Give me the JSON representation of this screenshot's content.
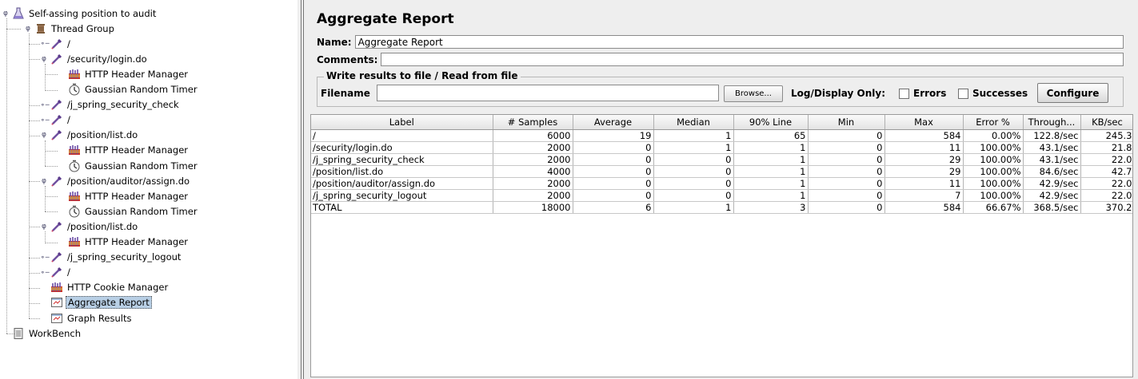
{
  "tree": {
    "items": [
      {
        "label": "Self-assing position to audit",
        "icon": "flask-icon"
      },
      {
        "label": "Thread Group",
        "icon": "spool-icon"
      },
      {
        "label": "/",
        "icon": "pipette-icon"
      },
      {
        "label": "/security/login.do",
        "icon": "pipette-icon"
      },
      {
        "label": "HTTP Header Manager",
        "icon": "header-manager-icon"
      },
      {
        "label": "Gaussian Random Timer",
        "icon": "timer-icon"
      },
      {
        "label": "/j_spring_security_check",
        "icon": "pipette-icon"
      },
      {
        "label": "/",
        "icon": "pipette-icon"
      },
      {
        "label": "/position/list.do",
        "icon": "pipette-icon"
      },
      {
        "label": "HTTP Header Manager",
        "icon": "header-manager-icon"
      },
      {
        "label": "Gaussian Random Timer",
        "icon": "timer-icon"
      },
      {
        "label": "/position/auditor/assign.do",
        "icon": "pipette-icon"
      },
      {
        "label": "HTTP Header Manager",
        "icon": "header-manager-icon"
      },
      {
        "label": "Gaussian Random Timer",
        "icon": "timer-icon"
      },
      {
        "label": "/position/list.do",
        "icon": "pipette-icon"
      },
      {
        "label": "HTTP Header Manager",
        "icon": "header-manager-icon"
      },
      {
        "label": "/j_spring_security_logout",
        "icon": "pipette-icon"
      },
      {
        "label": "/",
        "icon": "pipette-icon"
      },
      {
        "label": "HTTP Cookie Manager",
        "icon": "cookie-manager-icon"
      },
      {
        "label": "Aggregate Report",
        "icon": "report-icon",
        "selected": true
      },
      {
        "label": "Graph Results",
        "icon": "report-icon"
      },
      {
        "label": "WorkBench",
        "icon": "workbench-icon"
      }
    ]
  },
  "panel": {
    "title": "Aggregate Report",
    "name_label": "Name:",
    "name_value": "Aggregate Report",
    "comments_label": "Comments:",
    "comments_value": "",
    "file_group_legend": "Write results to file / Read from file",
    "filename_label": "Filename",
    "filename_value": "",
    "browse_label": "Browse...",
    "log_display_label": "Log/Display Only:",
    "errors_label": "Errors",
    "successes_label": "Successes",
    "configure_label": "Configure"
  },
  "table": {
    "columns": [
      "Label",
      "# Samples",
      "Average",
      "Median",
      "90% Line",
      "Min",
      "Max",
      "Error %",
      "Through...",
      "KB/sec"
    ],
    "rows": [
      [
        "/",
        "6000",
        "19",
        "1",
        "65",
        "0",
        "584",
        "0.00%",
        "122.8/sec",
        "245.3"
      ],
      [
        "/security/login.do",
        "2000",
        "0",
        "1",
        "1",
        "0",
        "11",
        "100.00%",
        "43.1/sec",
        "21.8"
      ],
      [
        "/j_spring_security_check",
        "2000",
        "0",
        "0",
        "1",
        "0",
        "29",
        "100.00%",
        "43.1/sec",
        "22.0"
      ],
      [
        "/position/list.do",
        "4000",
        "0",
        "0",
        "1",
        "0",
        "29",
        "100.00%",
        "84.6/sec",
        "42.7"
      ],
      [
        "/position/auditor/assign.do",
        "2000",
        "0",
        "0",
        "1",
        "0",
        "11",
        "100.00%",
        "42.9/sec",
        "22.0"
      ],
      [
        "/j_spring_security_logout",
        "2000",
        "0",
        "0",
        "1",
        "0",
        "7",
        "100.00%",
        "42.9/sec",
        "22.0"
      ],
      [
        "TOTAL",
        "18000",
        "6",
        "1",
        "3",
        "0",
        "584",
        "66.67%",
        "368.5/sec",
        "370.2"
      ]
    ]
  }
}
